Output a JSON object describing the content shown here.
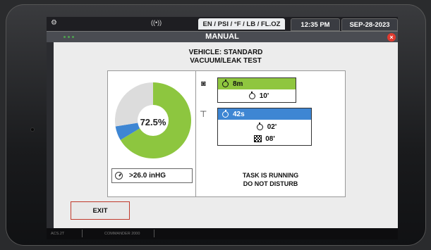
{
  "topbar": {
    "units": "EN / PSI / °F / LB / FL.OZ",
    "time": "12:35 PM",
    "date": "SEP-28-2023"
  },
  "window": {
    "title": "MANUAL",
    "close_label": "×"
  },
  "header": {
    "vehicle": "VEHICLE: STANDARD",
    "test": "VACUUM/LEAK TEST"
  },
  "progress": {
    "percent_label": "72.5%",
    "percent_value": 72.5,
    "colors": {
      "main": "#8dc63f",
      "secondary": "#3e86d3",
      "remaining": "#dcdcdc"
    }
  },
  "vacuum": {
    "value": ">26.0 inHG"
  },
  "steps": {
    "vacuum": {
      "current": "8m",
      "total": "10'"
    },
    "leak": {
      "current": "42s",
      "stopwatch": "02'",
      "finish": "08'"
    }
  },
  "status": {
    "line1": "TASK IS RUNNING",
    "line2": "DO NOT DISTURB"
  },
  "actions": {
    "exit_label": "EXIT"
  },
  "footer": {
    "left": "ACS.2T",
    "middle": "COMMANDER 2000"
  }
}
